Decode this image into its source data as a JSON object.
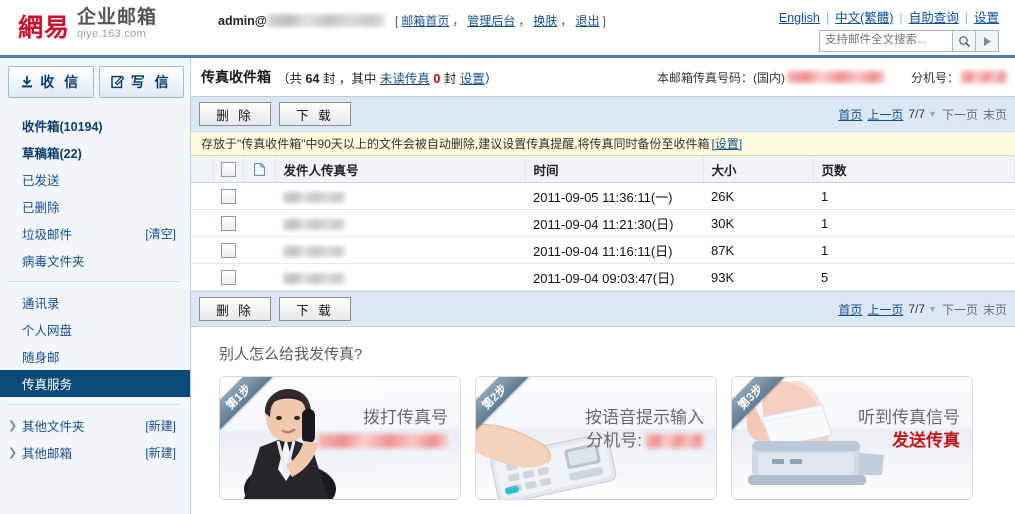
{
  "header": {
    "logo_cn": "網易",
    "logo_biz": "企业邮箱",
    "logo_url": "qiye.163.com",
    "account_prefix": "admin@",
    "account_links": [
      {
        "label": "邮箱首页"
      },
      {
        "label": "管理后台"
      },
      {
        "label": "换肤"
      },
      {
        "label": "退出"
      }
    ],
    "top_links": [
      {
        "label": "English"
      },
      {
        "label": "中文(繁體)"
      },
      {
        "label": "自助查询"
      },
      {
        "label": "设置"
      }
    ],
    "search": {
      "value": "",
      "placeholder": "支持邮件全文搜索..."
    }
  },
  "sidebar": {
    "receive_button": "收 信",
    "compose_button": "写 信",
    "items": [
      {
        "label": "收件箱(10194)",
        "bold": true,
        "action": ""
      },
      {
        "label": "草稿箱(22)",
        "bold": true,
        "action": ""
      },
      {
        "label": "已发送",
        "bold": false,
        "action": ""
      },
      {
        "label": "已删除",
        "bold": false,
        "action": ""
      },
      {
        "label": "垃圾邮件",
        "bold": false,
        "action": "[清空]"
      },
      {
        "label": "病毒文件夹",
        "bold": false,
        "action": ""
      }
    ],
    "items2": [
      {
        "label": "通讯录",
        "action": ""
      },
      {
        "label": "个人网盘",
        "action": ""
      },
      {
        "label": "随身邮",
        "action": ""
      },
      {
        "label": "传真服务",
        "action": "",
        "active": true
      }
    ],
    "items3": [
      {
        "label": "其他文件夹",
        "action": "[新建]"
      },
      {
        "label": "其他邮箱",
        "action": "[新建]"
      }
    ]
  },
  "main": {
    "title": "传真收件箱",
    "summary_open": "（共",
    "total_count": "64",
    "summary_mid1": "封 ，其中",
    "unread_link": "未读传真",
    "unread_count": "0",
    "summary_mid2": "封",
    "settings_link": "设置",
    "summary_close": "）",
    "fax_number_label": "本邮箱传真号码：(国内)",
    "fax_number_value": "",
    "extension_label": "分机号：",
    "extension_value": "",
    "toolbar": {
      "delete_label": "删 除",
      "download_label": "下 载"
    },
    "pager": {
      "first": "首页",
      "prev": "上一页",
      "current": "7/7",
      "next": "下一页",
      "last": "末页"
    },
    "notice": {
      "text": "存放于\"传真收件箱\"中90天以上的文件会被自动删除,建议设置传真提醒,将传真同时备份至收件箱",
      "link": "[设置]"
    },
    "table": {
      "columns": [
        "",
        "",
        "发件人传真号",
        "时间",
        "大小",
        "页数"
      ],
      "rows": [
        {
          "sender": "",
          "time": "2011-09-05 11:36:11(一)",
          "size": "26K",
          "pages": "1"
        },
        {
          "sender": "",
          "time": "2011-09-04 11:21:30(日)",
          "size": "30K",
          "pages": "1"
        },
        {
          "sender": "",
          "time": "2011-09-04 11:16:11(日)",
          "size": "87K",
          "pages": "1"
        },
        {
          "sender": "",
          "time": "2011-09-04 09:03:47(日)",
          "size": "93K",
          "pages": "5"
        }
      ]
    }
  },
  "promo": {
    "title": "别人怎么给我发传真?",
    "cards": [
      {
        "ribbon": "第1步",
        "line1": "拨打传真号",
        "line2": "",
        "redacted": true
      },
      {
        "ribbon": "第2步",
        "line1": "按语音提示输入",
        "line2": "分机号:",
        "redacted": true
      },
      {
        "ribbon": "第3步",
        "line1": "听到传真信号",
        "line2": "发送传真",
        "redacted": false
      }
    ]
  },
  "colors": {
    "accent": "#0e4a78",
    "link": "#1a4f8a",
    "toolbar_bg": "#dbe8f3",
    "notice_bg": "#fbfbdd",
    "red": "#c0171c"
  }
}
